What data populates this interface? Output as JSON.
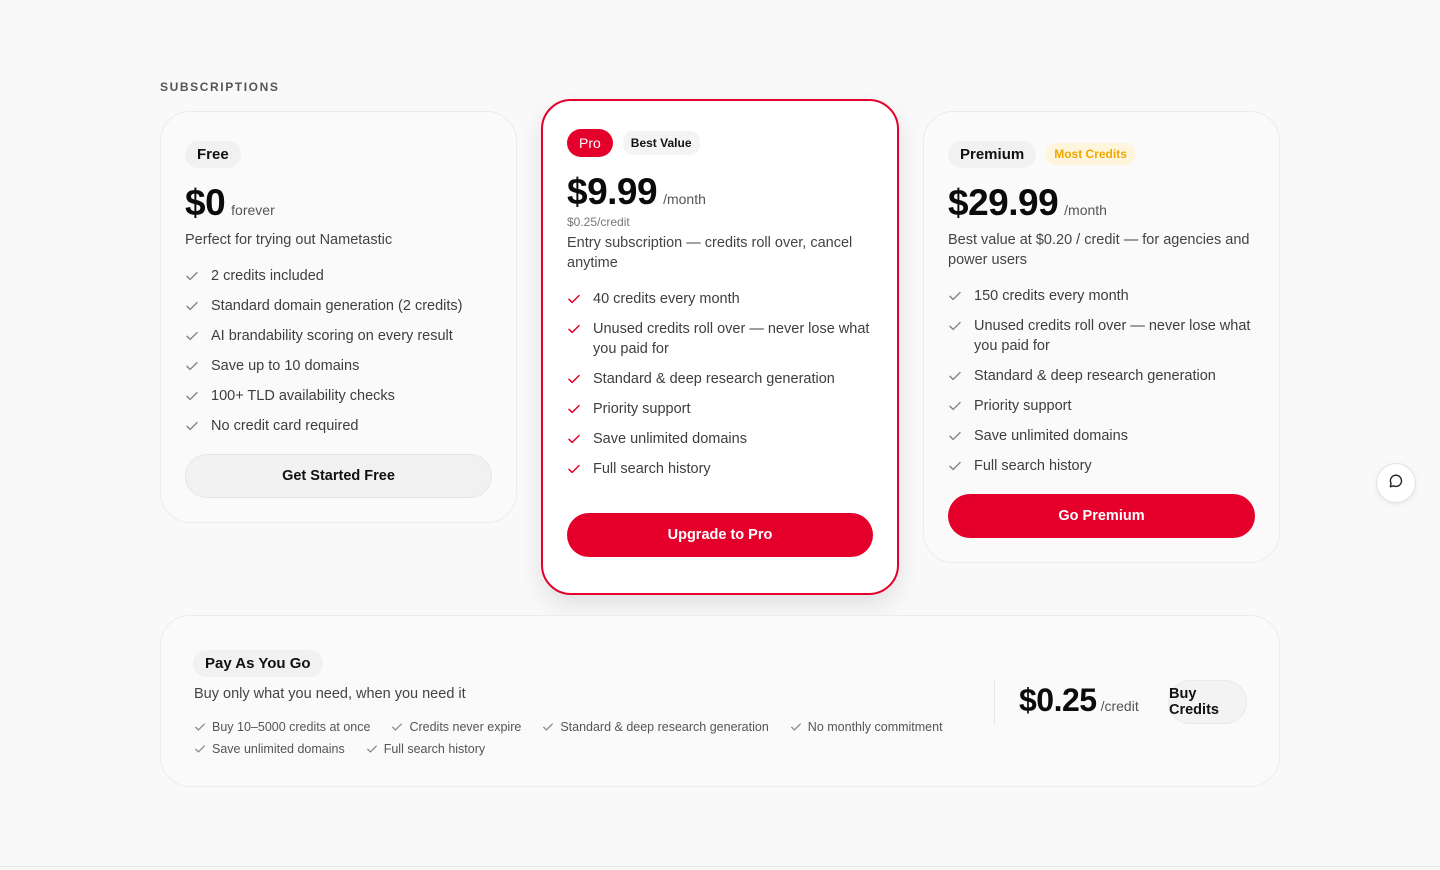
{
  "section_label": "SUBSCRIPTIONS",
  "colors": {
    "accent": "#e4002b",
    "most_credits": "#f0a800",
    "check_gray": "#8a8a8a"
  },
  "icons": {
    "check": "check-icon",
    "chat": "chat-bubble-icon"
  },
  "plans": {
    "free": {
      "name": "Free",
      "price": "$0",
      "period": "forever",
      "description": "Perfect for trying out Nametastic",
      "features": [
        "2 credits included",
        "Standard domain generation (2 credits)",
        "AI brandability scoring on every result",
        "Save up to 10 domains",
        "100+ TLD availability checks",
        "No credit card required"
      ],
      "cta": "Get Started Free"
    },
    "pro": {
      "name": "Pro",
      "badge": "Best Value",
      "price": "$9.99",
      "period": "/month",
      "per_credit": "$0.25/credit",
      "description": "Entry subscription — credits roll over, cancel anytime",
      "features": [
        "40 credits every month",
        "Unused credits roll over — never lose what you paid for",
        "Standard & deep research generation",
        "Priority support",
        "Save unlimited domains",
        "Full search history"
      ],
      "cta": "Upgrade to Pro"
    },
    "premium": {
      "name": "Premium",
      "badge": "Most Credits",
      "price": "$29.99",
      "period": "/month",
      "description": "Best value at $0.20 / credit — for agencies and power users",
      "features": [
        "150 credits every month",
        "Unused credits roll over — never lose what you paid for",
        "Standard & deep research generation",
        "Priority support",
        "Save unlimited domains",
        "Full search history"
      ],
      "cta": "Go Premium"
    }
  },
  "payg": {
    "name": "Pay As You Go",
    "description": "Buy only what you need, when you need it",
    "features": [
      "Buy 10–5000 credits at once",
      "Credits never expire",
      "Standard & deep research generation",
      "No monthly commitment",
      "Save unlimited domains",
      "Full search history"
    ],
    "price": "$0.25",
    "unit": "/credit",
    "cta": "Buy Credits"
  }
}
